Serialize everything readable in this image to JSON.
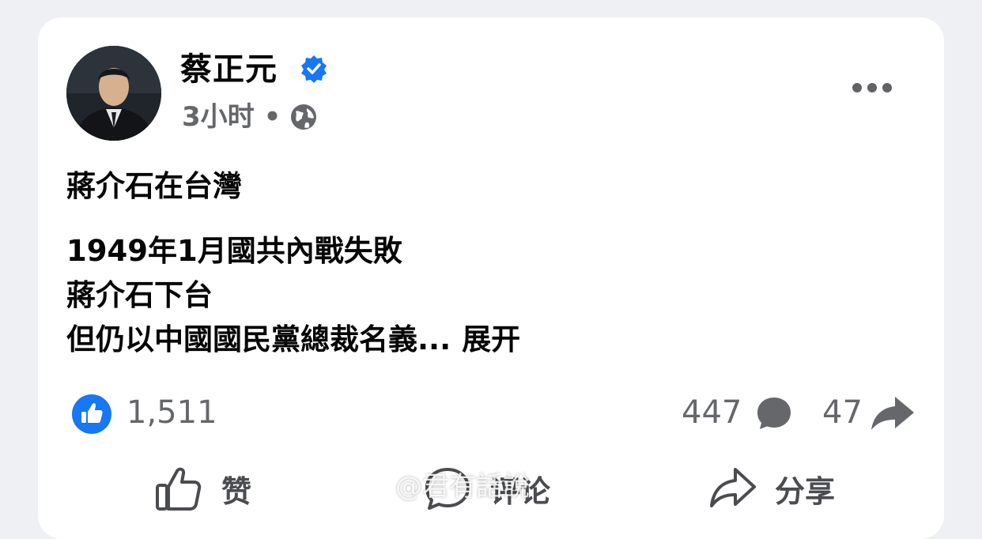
{
  "post": {
    "author": "蔡正元",
    "timestamp": "3小时",
    "separator": "•",
    "title": "蔣介石在台灣",
    "lines": [
      "1949年1月國共內戰失敗",
      "蔣介石下台",
      "但仍以中國國民黨總裁名義..."
    ],
    "see_more": "展开"
  },
  "stats": {
    "likes": "1,511",
    "comments": "447",
    "shares": "47"
  },
  "actions": {
    "like": "赞",
    "comment": "评论",
    "share": "分享"
  },
  "watermark": "@君有話說",
  "colors": {
    "accent": "#1877f2",
    "secondary_text": "#65676b",
    "background": "#eef0f3"
  },
  "icons": [
    "verified-badge-icon",
    "globe-icon",
    "more-options-icon",
    "like-badge-icon",
    "comment-icon",
    "share-icon",
    "thumbs-up-icon"
  ]
}
